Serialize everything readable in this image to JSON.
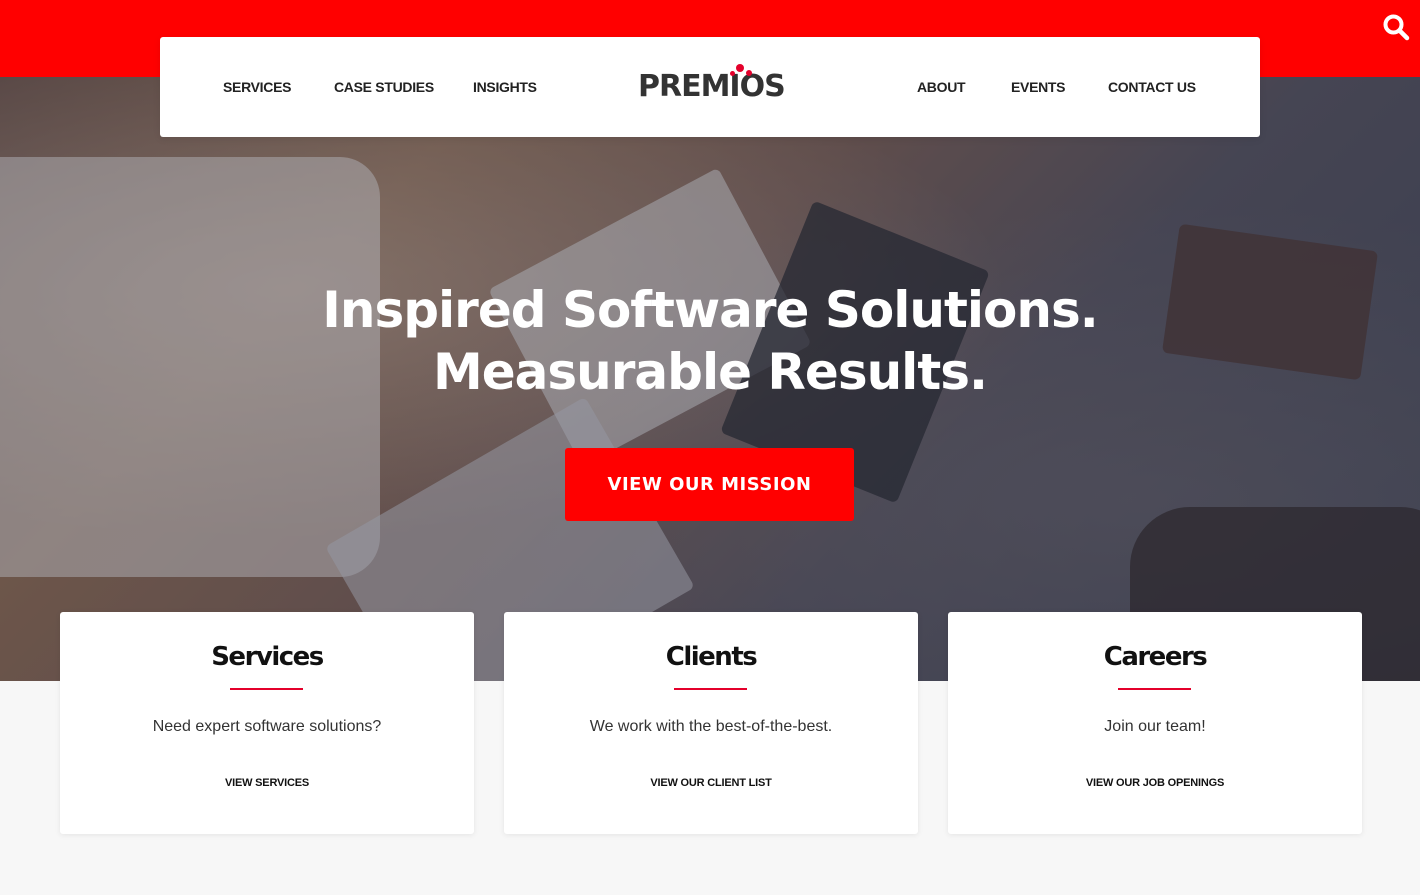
{
  "colors": {
    "brand_red": "#ff0000",
    "accent_red": "#e4002b",
    "text_dark": "#222222",
    "background": "#f7f7f7"
  },
  "search": {
    "icon": "search-icon"
  },
  "nav": {
    "left_links": [
      "SERVICES",
      "CASE STUDIES",
      "INSIGHTS"
    ],
    "right_links": [
      "ABOUT",
      "EVENTS",
      "CONTACT US"
    ]
  },
  "logo": {
    "text": "PREMIOS"
  },
  "hero": {
    "title_line1": "Inspired Software Solutions.",
    "title_line2": "Measurable Results.",
    "cta_label": "VIEW OUR MISSION"
  },
  "cards": [
    {
      "title": "Services",
      "text": "Need expert software solutions?",
      "link": "VIEW SERVICES"
    },
    {
      "title": "Clients",
      "text": "We work with the best-of-the-best.",
      "link": "VIEW OUR CLIENT LIST"
    },
    {
      "title": "Careers",
      "text": "Join our team!",
      "link": "VIEW OUR JOB OPENINGS"
    }
  ]
}
